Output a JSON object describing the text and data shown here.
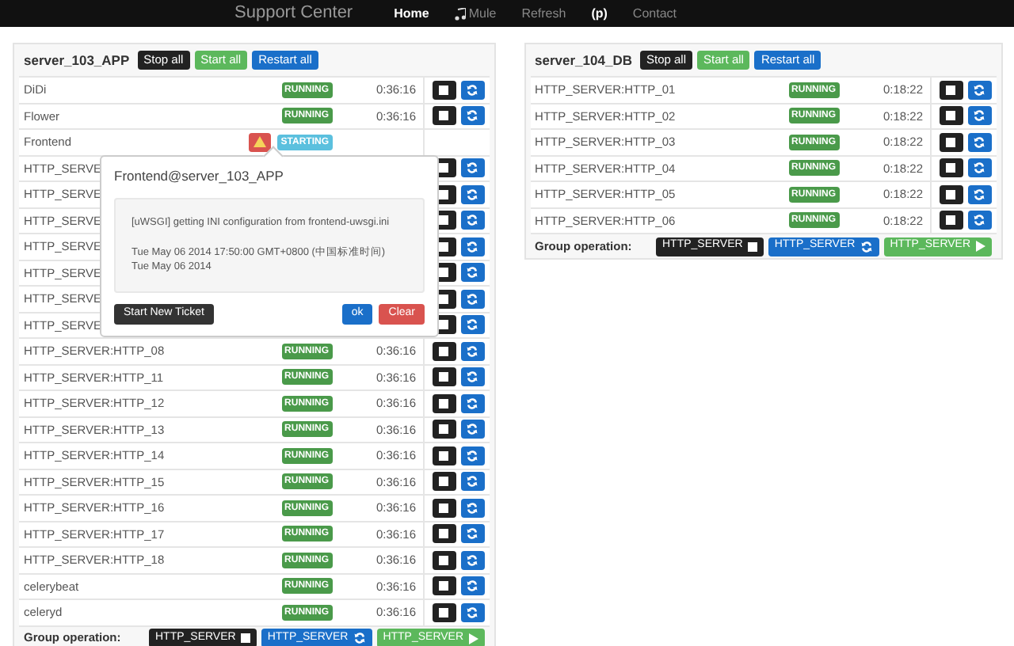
{
  "navbar": {
    "brand": "Support Center",
    "links": [
      {
        "label": "Home",
        "selected": true,
        "icon": false
      },
      {
        "label": "Mule",
        "selected": false,
        "icon": true
      },
      {
        "label": "Refresh",
        "selected": false,
        "icon": false
      },
      {
        "label": "(p)",
        "selected": true,
        "icon": false
      },
      {
        "label": "Contact",
        "selected": false,
        "icon": false
      }
    ]
  },
  "panels": [
    {
      "name": "server_103_APP",
      "buttons": [
        {
          "label": "Stop all",
          "kind": "stop"
        },
        {
          "label": "Start all",
          "kind": "start"
        },
        {
          "label": "Restart all",
          "kind": "restart"
        }
      ],
      "rows": [
        {
          "kind": "normal",
          "name": "DiDi",
          "status": {
            "label": "RUNNING",
            "kind": "running"
          },
          "time": "0:36:16"
        },
        {
          "kind": "normal",
          "name": "Flower",
          "status": {
            "label": "RUNNING",
            "kind": "running"
          },
          "time": "0:36:16"
        },
        {
          "kind": "alert",
          "name": "Frontend",
          "status": {
            "label": "STARTING",
            "kind": "starting"
          }
        },
        {
          "kind": "covered",
          "name": "HTTP_SERVE"
        },
        {
          "kind": "covered",
          "name": "HTTP_SERVE"
        },
        {
          "kind": "covered",
          "name": "HTTP_SERVE"
        },
        {
          "kind": "covered",
          "name": "HTTP_SERVE"
        },
        {
          "kind": "covered",
          "name": "HTTP_SERVE"
        },
        {
          "kind": "covered",
          "name": "HTTP_SERVE"
        },
        {
          "kind": "covered",
          "name": "HTTP_SERVE"
        },
        {
          "kind": "normal",
          "name": "HTTP_SERVER:HTTP_08",
          "status": {
            "label": "RUNNING",
            "kind": "running"
          },
          "time": "0:36:16"
        },
        {
          "kind": "normal",
          "name": "HTTP_SERVER:HTTP_11",
          "status": {
            "label": "RUNNING",
            "kind": "running"
          },
          "time": "0:36:16"
        },
        {
          "kind": "normal",
          "name": "HTTP_SERVER:HTTP_12",
          "status": {
            "label": "RUNNING",
            "kind": "running"
          },
          "time": "0:36:16"
        },
        {
          "kind": "normal",
          "name": "HTTP_SERVER:HTTP_13",
          "status": {
            "label": "RUNNING",
            "kind": "running"
          },
          "time": "0:36:16"
        },
        {
          "kind": "normal",
          "name": "HTTP_SERVER:HTTP_14",
          "status": {
            "label": "RUNNING",
            "kind": "running"
          },
          "time": "0:36:16"
        },
        {
          "kind": "normal",
          "name": "HTTP_SERVER:HTTP_15",
          "status": {
            "label": "RUNNING",
            "kind": "running"
          },
          "time": "0:36:16"
        },
        {
          "kind": "normal",
          "name": "HTTP_SERVER:HTTP_16",
          "status": {
            "label": "RUNNING",
            "kind": "running"
          },
          "time": "0:36:16"
        },
        {
          "kind": "normal",
          "name": "HTTP_SERVER:HTTP_17",
          "status": {
            "label": "RUNNING",
            "kind": "running"
          },
          "time": "0:36:16"
        },
        {
          "kind": "normal",
          "name": "HTTP_SERVER:HTTP_18",
          "status": {
            "label": "RUNNING",
            "kind": "running"
          },
          "time": "0:36:16"
        },
        {
          "kind": "normal",
          "name": "celerybeat",
          "status": {
            "label": "RUNNING",
            "kind": "running"
          },
          "time": "0:36:16"
        },
        {
          "kind": "normal",
          "name": "celeryd",
          "status": {
            "label": "RUNNING",
            "kind": "running"
          },
          "time": "0:36:16"
        }
      ],
      "group": {
        "label": "Group operation:",
        "buttons": [
          {
            "label": "HTTP_SERVER",
            "kind": "stop"
          },
          {
            "label": "HTTP_SERVER",
            "kind": "restart"
          },
          {
            "label": "HTTP_SERVER",
            "kind": "start"
          }
        ]
      },
      "popover": {
        "title": "Frontend@server_103_APP",
        "lines": [
          "[uWSGI] getting INI configuration from frontend-uwsgi.ini",
          "Tue May 06 2014 17:50:00 GMT+0800 (中国标准时间)",
          "Tue May 06 2014"
        ],
        "buttons": [
          {
            "label": "Start New Ticket",
            "kind": "ticket"
          },
          {
            "label": "ok",
            "kind": "ok"
          },
          {
            "label": "Clear",
            "kind": "clear"
          }
        ]
      }
    },
    {
      "name": "server_104_DB",
      "buttons": [
        {
          "label": "Stop all",
          "kind": "stop"
        },
        {
          "label": "Start all",
          "kind": "start"
        },
        {
          "label": "Restart all",
          "kind": "restart"
        }
      ],
      "rows": [
        {
          "kind": "normal",
          "name": "HTTP_SERVER:HTTP_01",
          "status": {
            "label": "RUNNING",
            "kind": "running"
          },
          "time": "0:18:22"
        },
        {
          "kind": "normal",
          "name": "HTTP_SERVER:HTTP_02",
          "status": {
            "label": "RUNNING",
            "kind": "running"
          },
          "time": "0:18:22"
        },
        {
          "kind": "normal",
          "name": "HTTP_SERVER:HTTP_03",
          "status": {
            "label": "RUNNING",
            "kind": "running"
          },
          "time": "0:18:22"
        },
        {
          "kind": "normal",
          "name": "HTTP_SERVER:HTTP_04",
          "status": {
            "label": "RUNNING",
            "kind": "running"
          },
          "time": "0:18:22"
        },
        {
          "kind": "normal",
          "name": "HTTP_SERVER:HTTP_05",
          "status": {
            "label": "RUNNING",
            "kind": "running"
          },
          "time": "0:18:22"
        },
        {
          "kind": "normal",
          "name": "HTTP_SERVER:HTTP_06",
          "status": {
            "label": "RUNNING",
            "kind": "running"
          },
          "time": "0:18:22"
        }
      ],
      "group": {
        "label": "Group operation:",
        "buttons": [
          {
            "label": "HTTP_SERVER",
            "kind": "stop"
          },
          {
            "label": "HTTP_SERVER",
            "kind": "restart"
          },
          {
            "label": "HTTP_SERVER",
            "kind": "start"
          }
        ]
      }
    }
  ]
}
